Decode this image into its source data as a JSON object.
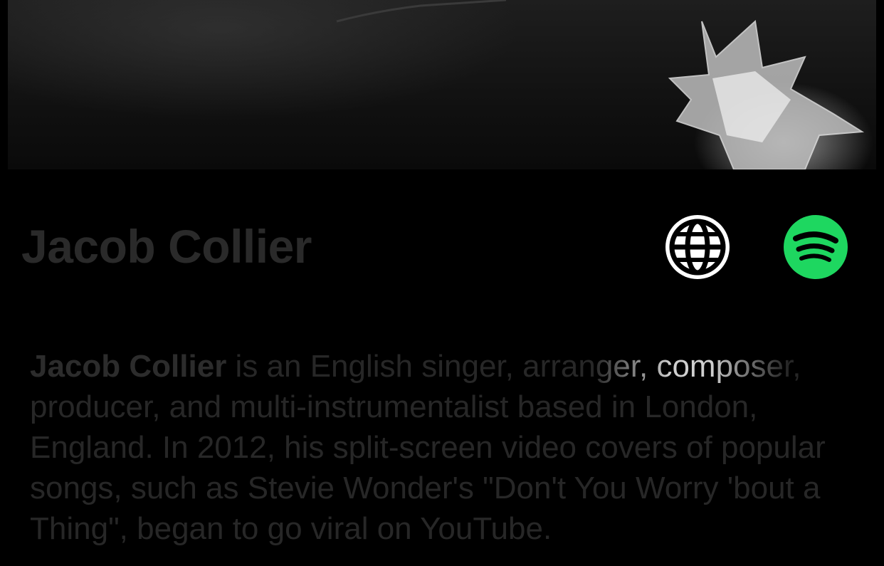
{
  "artist": {
    "name": "Jacob Collier"
  },
  "links": {
    "website_icon": "globe-icon",
    "spotify_icon": "spotify-icon",
    "spotify_color": "#1ED760"
  },
  "bio": {
    "name": "Jacob Collier",
    "text_before": " is an English singer, arran",
    "text_highlight": "ger, compose",
    "text_after": "r, producer, and multi-instrumentalist based in London, England. In 2012, his split-screen video covers of popular songs, such as Stevie Wonder's \"Don't You Worry 'bout a Thing\", began to go viral on YouTube."
  },
  "colors": {
    "background": "#000000",
    "heading": "#2a2a2a",
    "body_text": "#272727"
  }
}
